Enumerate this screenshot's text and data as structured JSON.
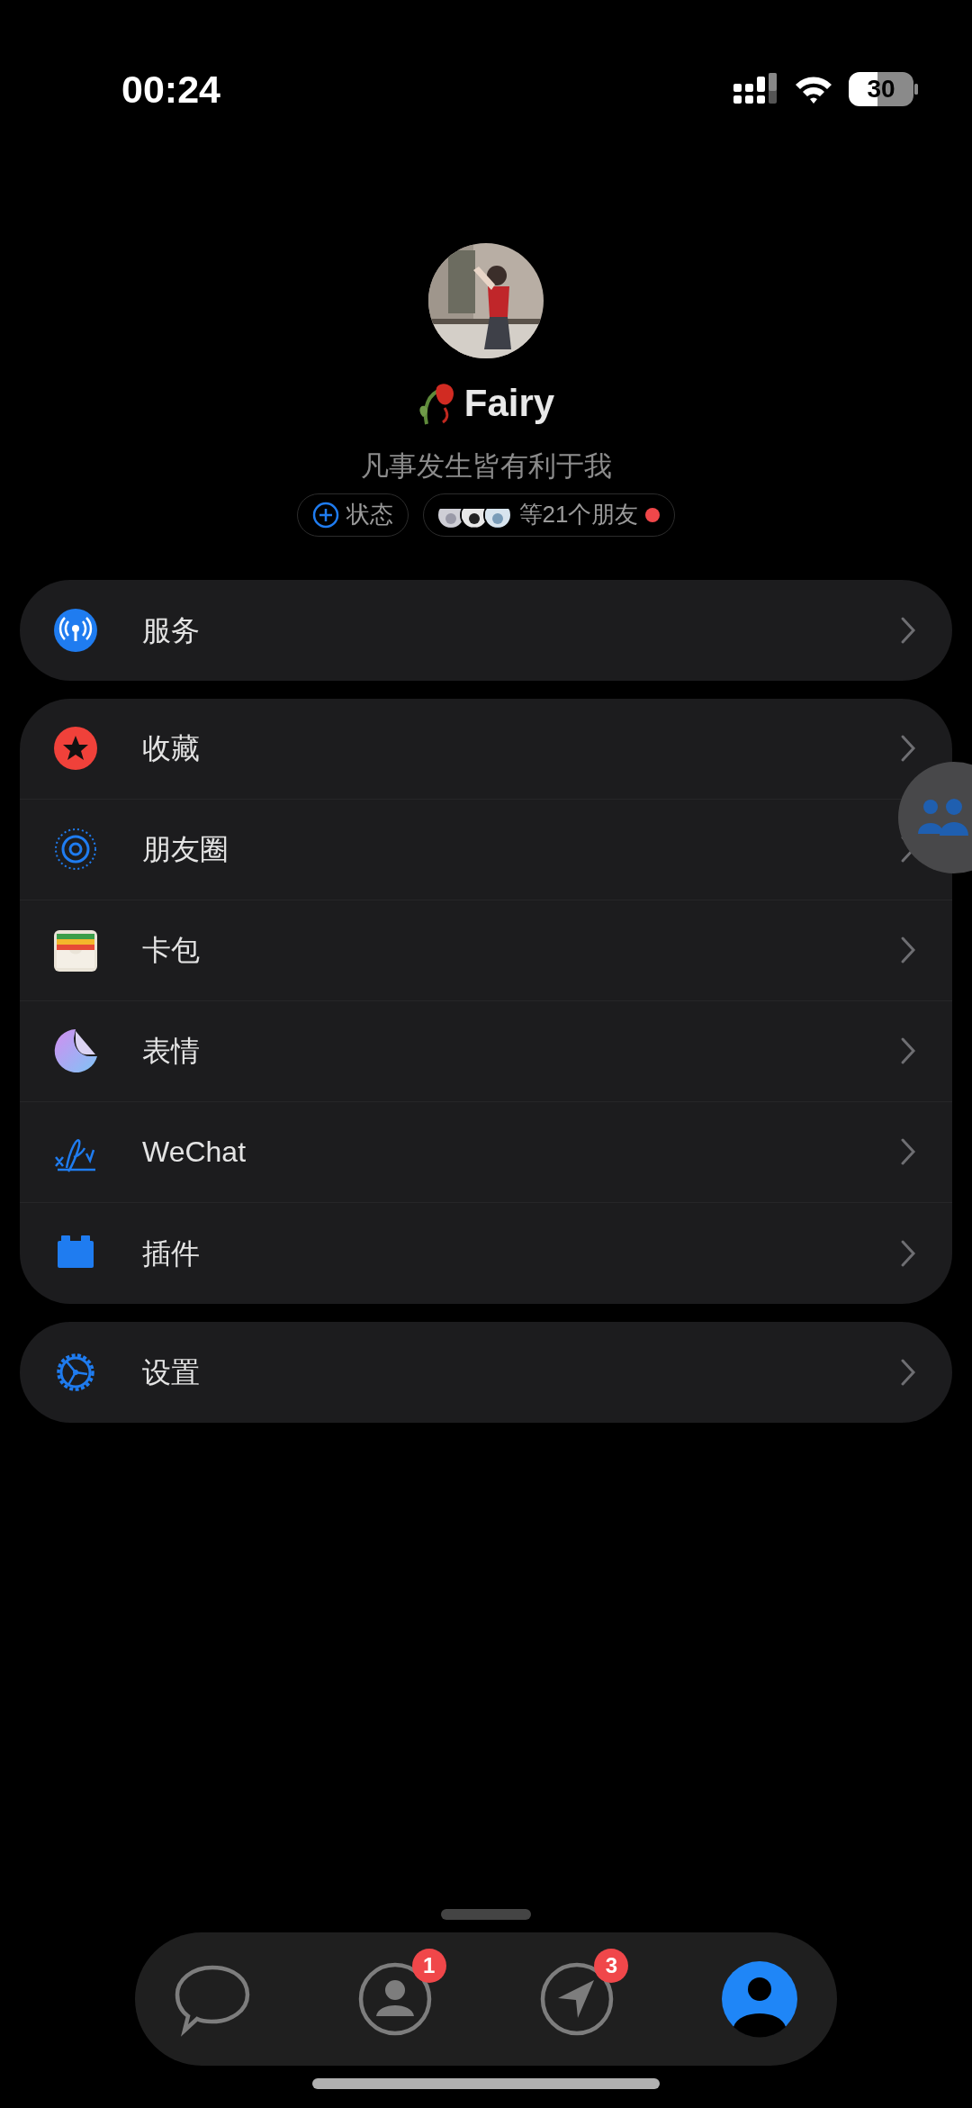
{
  "status_bar": {
    "time": "00:24",
    "battery": "30"
  },
  "profile": {
    "name": "Fairy",
    "signature": "凡事发生皆有利于我",
    "status_button": "状态",
    "friends_label": "等21个朋友",
    "friends_unread": true
  },
  "sections": [
    {
      "items": [
        {
          "label": "服务"
        }
      ]
    },
    {
      "items": [
        {
          "label": "收藏"
        },
        {
          "label": "朋友圈"
        },
        {
          "label": "卡包"
        },
        {
          "label": "表情"
        },
        {
          "label": "WeChat"
        },
        {
          "label": "插件"
        }
      ]
    },
    {
      "items": [
        {
          "label": "设置"
        }
      ]
    }
  ],
  "tabs": [
    {
      "selected": false
    },
    {
      "selected": false,
      "badge": "1"
    },
    {
      "selected": false,
      "badge": "3"
    },
    {
      "selected": true
    }
  ]
}
